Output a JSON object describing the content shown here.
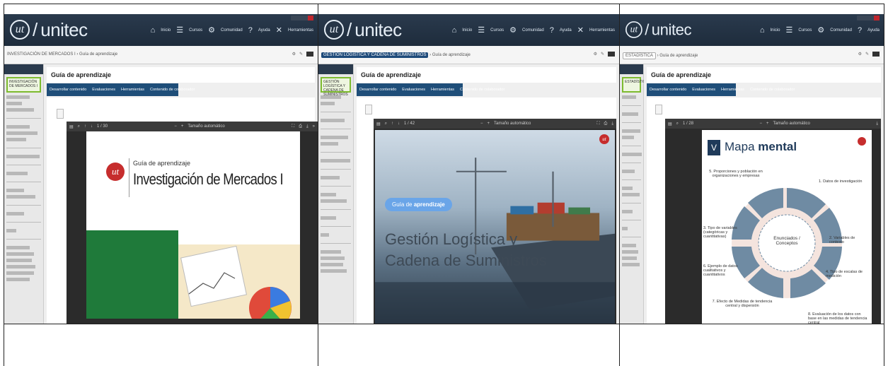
{
  "panels": [
    {
      "brand": "unitec",
      "nav": [
        "Inicio",
        "Cursos",
        "Comunidad",
        "Ayuda",
        "Herramientas"
      ],
      "breadcrumb_course": "INVESTIGACIÓN DE MERCADOS I",
      "breadcrumb_page": "Guía de aprendizaje",
      "sidebar_course": "INVESTIGACIÓN DE MERCADOS I",
      "page_title": "Guía de aprendizaje",
      "tabs": [
        "Desarrollar contenido",
        "Evaluaciones",
        "Herramientas",
        "Contenido de colaborador"
      ],
      "viewer_page": "1 / 30",
      "viewer_zoom": "Tamaño automático",
      "slide_label": "Guía de aprendizaje",
      "slide_title": "Investigación de Mercados I",
      "accent": "#c62d2d"
    },
    {
      "brand": "unitec",
      "nav": [
        "Inicio",
        "Cursos",
        "Comunidad",
        "Ayuda",
        "Herramientas"
      ],
      "breadcrumb_course": "GESTIÓN LOGÍSTICA Y CADENA DE SUMINISTROS",
      "breadcrumb_page": "Guía de aprendizaje",
      "sidebar_course": "GESTIÓN LOGÍSTICA Y CADENA DE SUMINISTROS",
      "page_title": "Guía de aprendizaje",
      "tabs": [
        "Desarrollar contenido",
        "Evaluaciones",
        "Herramientas",
        "Contenido de colaborador"
      ],
      "viewer_page": "1 / 42",
      "viewer_zoom": "Tamaño automático",
      "slide_chip_prefix": "Guía de",
      "slide_chip_bold": "aprendizaje",
      "slide_title_line1": "Gestión Logística y",
      "slide_title_line2": "Cadena de Suministros",
      "accent": "#4a90e2"
    },
    {
      "brand": "unitec",
      "nav": [
        "Inicio",
        "Cursos",
        "Comunidad",
        "Ayuda"
      ],
      "breadcrumb_course": "ESTADÍSTICA",
      "breadcrumb_page": "Guía de aprendizaje",
      "sidebar_course": "ESTADÍSTICA",
      "page_title": "Guía de aprendizaje",
      "tabs": [
        "Desarrollar contenido",
        "Evaluaciones",
        "Herramientas",
        "Contenido de colaborador"
      ],
      "viewer_page": "1 / 28",
      "viewer_zoom": "Tamaño automático",
      "slide_num": "V",
      "slide_title_light": "Mapa",
      "slide_title_bold": "mental",
      "center_text": "Enunciados / Conceptos",
      "mindmap_items": [
        "5. Proporciones y población en organizaciones y empresas",
        "1. Datos de investigación",
        "2. Variables de contexto",
        "3. Tipo de variables (categóricas y cuantitativas)",
        "4. Tipo de escalas de medición",
        "6. Ejemplo de datos cualitativos y cuantitativos",
        "7. Efecto de Medidas de tendencia central y dispersión",
        "8. Evaluación de los datos con base en las medidas de tendencia central"
      ]
    }
  ]
}
